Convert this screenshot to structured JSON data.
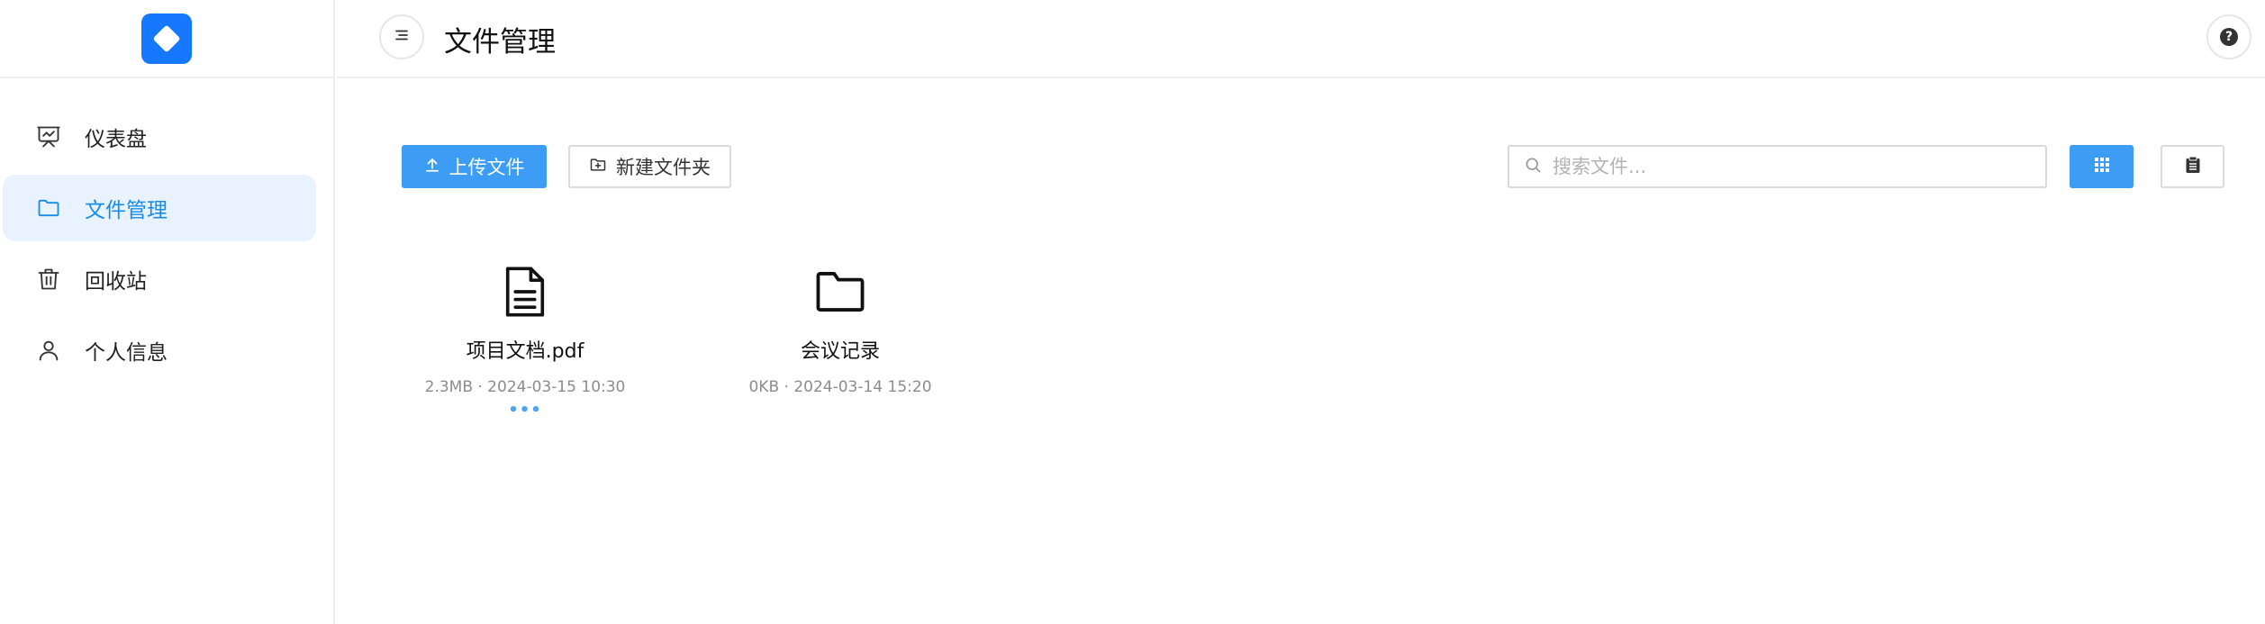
{
  "app": {
    "accent": "#1677ff",
    "primary_button": "#3d9df5"
  },
  "sidebar": {
    "items": [
      {
        "label": "仪表盘",
        "icon": "presentation-chart-icon"
      },
      {
        "label": "文件管理",
        "icon": "folder-icon",
        "active": true
      },
      {
        "label": "回收站",
        "icon": "trash-icon"
      },
      {
        "label": "个人信息",
        "icon": "user-icon"
      }
    ]
  },
  "header": {
    "title": "文件管理",
    "menu_icon": "menu-icon",
    "help_icon": "help-icon"
  },
  "toolbar": {
    "upload_label": "上传文件",
    "new_folder_label": "新建文件夹",
    "search_placeholder": "搜索文件...",
    "search_value": "",
    "view_grid_icon": "grid-view-icon",
    "view_list_icon": "clipboard-list-icon",
    "active_view": "grid"
  },
  "files": [
    {
      "name": "项目文档.pdf",
      "meta": "2.3MB · 2024-03-15 10:30",
      "type": "document",
      "more": "•••"
    },
    {
      "name": "会议记录",
      "meta": "0KB · 2024-03-14 15:20",
      "type": "folder"
    }
  ]
}
